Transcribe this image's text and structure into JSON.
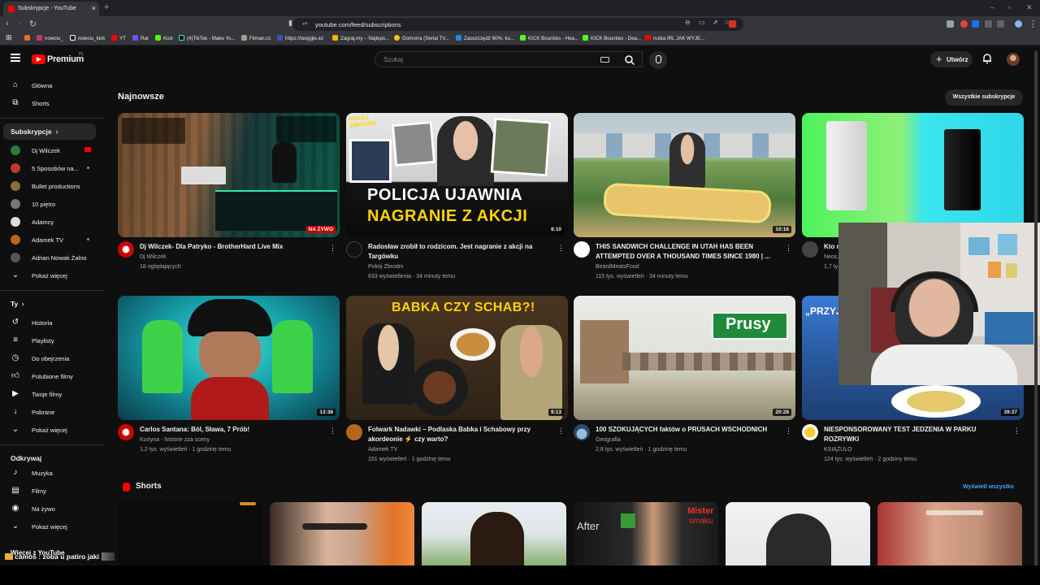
{
  "browser": {
    "tab_title": "Subskrypcje - YouTube",
    "new_tab": "+",
    "url": "youtube.com/feed/subscriptions",
    "bookmarks": [
      "nowciu_",
      "nowciu_kick",
      "YT",
      "Rat",
      "Kick",
      "(4)TikTok - Make Yo...",
      "Filman.cc",
      "https://tanggle.io/",
      "Zagraj.my – Najleps...",
      "Gomorra (Serial TV...",
      "Zaoszczędź 60%, ku...",
      "KICK Bounties - Hea...",
      "KICK Bounties - Dea...",
      "nutka IRL JAK WYJE..."
    ]
  },
  "header": {
    "logo_text": "Premium",
    "logo_region": "PL",
    "search_placeholder": "Szukaj",
    "create_label": "Utwórz"
  },
  "sidebar": {
    "main": [
      {
        "label": "Główna",
        "icon": "home-icon"
      },
      {
        "label": "Shorts",
        "icon": "shorts-icon"
      }
    ],
    "subscriptions_title": "Subskrypcje",
    "subscriptions": [
      {
        "label": "Dj Wilczek",
        "color": "#2a7a3a",
        "live": true
      },
      {
        "label": "5 Sposobów na...",
        "color": "#c0392b",
        "dot": true
      },
      {
        "label": "Bullet productions",
        "color": "#8a6d3b"
      },
      {
        "label": "10 piętro",
        "color": "#777777"
      },
      {
        "label": "Adamcy",
        "color": "#dddddd"
      },
      {
        "label": "Adamek TV",
        "color": "#b5651d",
        "dot": true
      },
      {
        "label": "Adrian Nowak Żalno",
        "color": "#555555"
      }
    ],
    "show_more_1": "Pokaż więcej",
    "you_title": "Ty",
    "you_items": [
      {
        "label": "Historia",
        "icon": "history-icon"
      },
      {
        "label": "Playlisty",
        "icon": "playlist-icon"
      },
      {
        "label": "Do obejrzenia",
        "icon": "watch-later-icon"
      },
      {
        "label": "Polubione filmy",
        "icon": "like-icon"
      },
      {
        "label": "Twoje filmy",
        "icon": "your-videos-icon"
      },
      {
        "label": "Pobrane",
        "icon": "download-icon"
      }
    ],
    "show_more_2": "Pokaż więcej",
    "explore_title": "Odkrywaj",
    "explore_items": [
      {
        "label": "Muzyka",
        "icon": "music-icon"
      },
      {
        "label": "Filmy",
        "icon": "movies-icon"
      },
      {
        "label": "Na żywo",
        "icon": "live-icon"
      }
    ],
    "show_more_3": "Pokaż więcej",
    "more_from": "Więcej z YouTube"
  },
  "main": {
    "section_title": "Najnowsze",
    "all_subs_button": "Wszystkie subskrypcje",
    "videos": [
      {
        "title": "Dj Wilczek- Dla Patryko - BrotherHard Live Mix",
        "channel": "Dj Wilczek",
        "meta": "18 oglądających",
        "badge": "NA ŻYWO",
        "live": true
      },
      {
        "title": "Radosław zrobił to rodzicom. Jest nagranie z akcji na Targówku",
        "channel": "Pokój Zbrodni",
        "meta": "633 wyświetlenia · 34 minuty temu",
        "duration": "8:10",
        "thumb_text_1": "POLICJA UJAWNIA",
        "thumb_text_2": "NAGRANIE Z AKCJI",
        "thumb_corner": "POKÓJ ZBRODNI"
      },
      {
        "title": "THIS SANDWICH CHALLENGE IN UTAH HAS BEEN ATTEMPTED OVER A THOUSAND TIMES SINCE 1980 | ...",
        "channel": "BeardMeatsFood",
        "meta": "115 tys. wyświetleń · 34 minuty temu",
        "duration": "10:16"
      },
      {
        "title": "Kto n...",
        "channel": "Neos...",
        "meta": "1,7 ty...",
        "duration": ""
      },
      {
        "title": "Carlos Santana: Ból, Sława, 7 Prób!",
        "channel": "Kurtyna - historie zza sceny",
        "meta": "1,2 tys. wyświetleń · 1 godzinę temu",
        "duration": "13:38"
      },
      {
        "title": "Folwark Nadawki – Podlaska Babka i Schabowy przy akordeonie ⚡ czy warto?",
        "channel": "Adamek TV",
        "meta": "151 wyświetleń · 1 godzinę temu",
        "duration": "9:13",
        "thumb_text_1": "BABKA CZY SCHAB?!"
      },
      {
        "title": "100 SZOKUJĄCYCH faktów o PRUSACH WSCHODNICH",
        "channel": "Geografia",
        "meta": "2,8 tys. wyświetleń · 1 godzinę temu",
        "duration": "20:28",
        "thumb_text_1": "Prusy"
      },
      {
        "title": "NIESPONSOROWANY TEST JEDZENIA W PARKU ROZRYWKI",
        "channel": "KSIĄŻULO",
        "meta": "124 tys. wyświetleń · 2 godziny temu",
        "duration": "39:37",
        "thumb_text_1": "„PRZYJ..."
      }
    ],
    "shorts_title": "Shorts",
    "shorts_view_all": "Wyświetl wszystko",
    "shorts_brand_1": "Mister",
    "shorts_brand_2": "smaku",
    "shorts_after": "After"
  },
  "chat": {
    "user": "camos",
    "message": "camos : zoba u patiro jaki"
  },
  "colors": {
    "background": "#0f0f0f",
    "accent_red": "#ff0000",
    "link_blue": "#3ea6ff"
  }
}
